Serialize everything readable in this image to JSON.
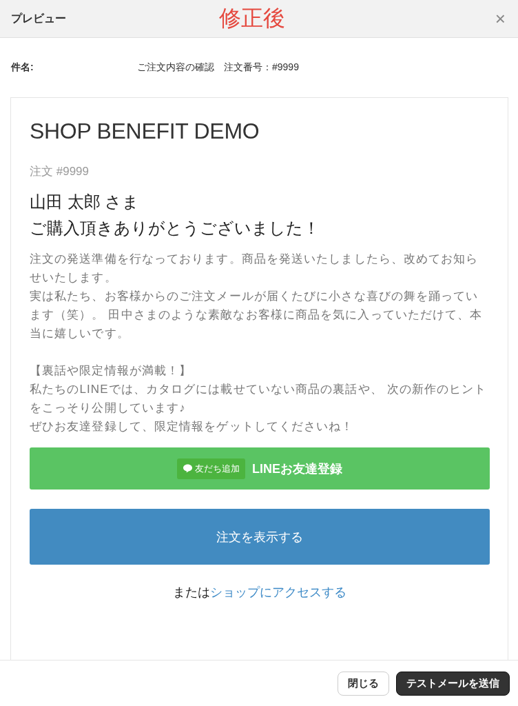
{
  "dialog": {
    "title": "プレビュー",
    "annotation": "修正後",
    "close_label": "×"
  },
  "subject": {
    "label": "件名:",
    "value": "ご注文内容の確認　注文番号：#9999"
  },
  "email": {
    "shop_name": "SHOP BENEFIT DEMO",
    "order_label": "注文 #9999",
    "greeting_lines": [
      "山田 太郎 さま",
      "ご購入頂きありがとうございました！"
    ],
    "paragraphs": [
      {
        "lines": [
          "注文の発送準備を行なっております。商品を発送いたしましたら、改めてお知らせいたします。",
          "実は私たち、お客様からのご注文メールが届くたびに小さな喜びの舞を踊っています（笑）。 田中さまのような素敵なお客様に商品を気に入っていただけて、本当に嬉しいです。"
        ]
      },
      {
        "lines": [
          "【裏話や限定情報が満載！】",
          "私たちのLINEでは、カタログには載せていない商品の裏話や、 次の新作のヒントをこっそり公開しています♪",
          "ぜひお友達登録して、限定情報をゲットしてくださいね！"
        ]
      }
    ],
    "line_button": {
      "badge": "友だち追加",
      "label": "LINEお友達登録"
    },
    "order_button": "注文を表示する",
    "shop_link": {
      "prefix": "または",
      "link": "ショップにアクセスする"
    }
  },
  "footer": {
    "buttons": [
      {
        "label": "閉じる",
        "kind": "secondary"
      },
      {
        "label": "テストメールを送信",
        "kind": "primary"
      }
    ]
  }
}
